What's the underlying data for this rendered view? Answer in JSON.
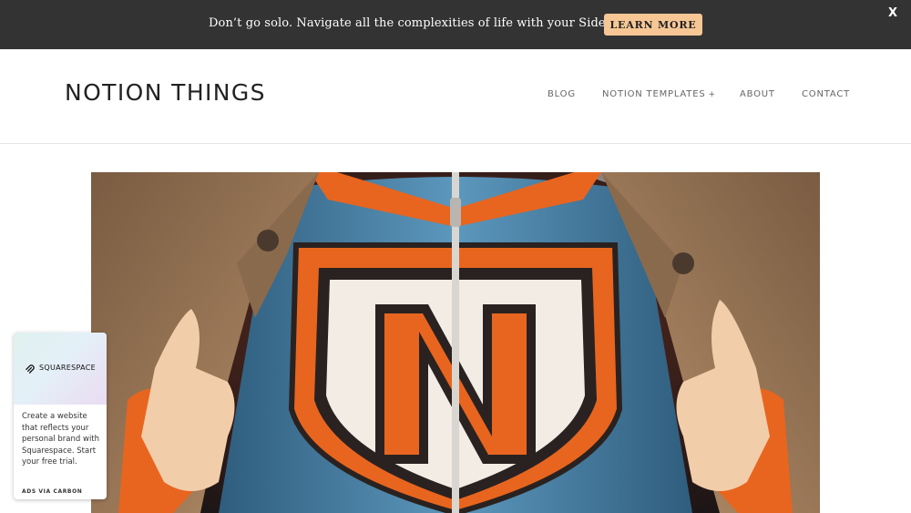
{
  "announcement": {
    "text": "Don’t go solo. Navigate all the complexities of life with your Sidekick",
    "button_label": "LEARN MORE",
    "close_label": "X"
  },
  "header": {
    "site_title": "NOTION THINGS",
    "nav": [
      {
        "label": "BLOG"
      },
      {
        "label": "NOTION TEMPLATES",
        "icon": "plus-icon",
        "icon_glyph": "+"
      },
      {
        "label": "ABOUT"
      },
      {
        "label": "CONTACT"
      }
    ]
  },
  "hero": {
    "icon": "notion-superhero-emblem"
  },
  "ad": {
    "brand": "SQUARESPACE",
    "copy": "Create a website that reflects your personal brand with Squarespace. Start your free trial.",
    "via_label": "ADS VIA CARBON"
  },
  "colors": {
    "announce_bg": "#333333",
    "button_bg": "#f6c795",
    "emblem_orange": "#e8651f",
    "suit_blue": "#4f8ab0",
    "jacket_tan": "#a88462"
  }
}
